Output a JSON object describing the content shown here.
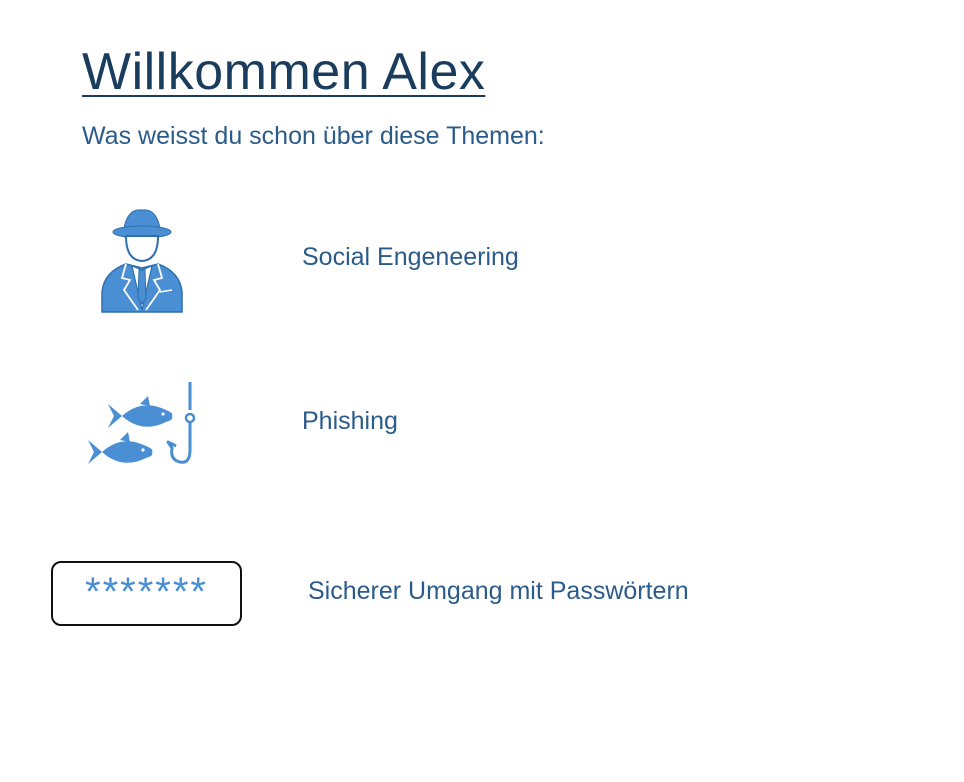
{
  "header": {
    "title": "Willkommen Alex",
    "subtitle": "Was weisst du schon über diese Themen:"
  },
  "topics": [
    {
      "label": "Social Engeneering",
      "icon": "spy-icon"
    },
    {
      "label": "Phishing",
      "icon": "fish-hook-icon"
    },
    {
      "label": "Sicherer Umgang mit Passwörtern",
      "icon": "password-field-icon",
      "mask": "*******"
    }
  ],
  "colors": {
    "title": "#1a3d5e",
    "text": "#2a5b8a",
    "icon": "#4a8fd4"
  }
}
